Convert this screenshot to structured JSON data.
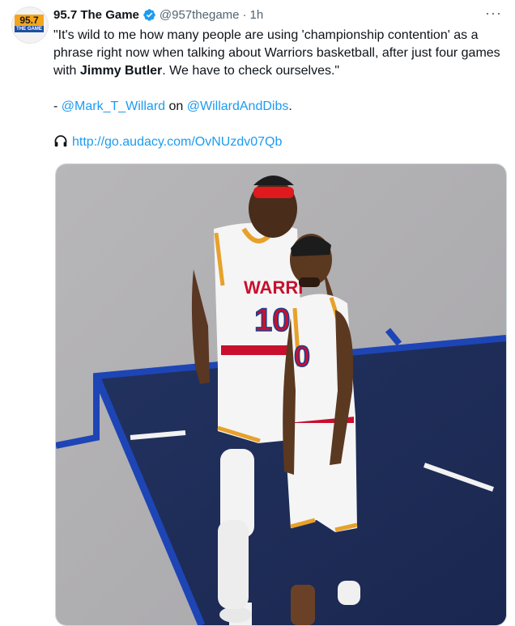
{
  "account": {
    "name": "95.7 The Game",
    "handle": "@957thegame",
    "separator": "·",
    "time": "1h",
    "avatar_lines": [
      "95.7",
      "THE GAME"
    ],
    "verified_icon": "verified-badge-icon",
    "more_label": "···"
  },
  "tweet": {
    "quote_part1": "\"It's wild to me how many people are using 'championship contention' as a phrase right now when talking about Warriors basketball, after just four games with ",
    "quote_bold": "Jimmy Butler",
    "quote_part2": ". We have to check ourselves.\"",
    "attribution_prefix": "- ",
    "attribution_user": "@Mark_T_Willard",
    "attribution_mid": " on ",
    "attribution_show": "@WillardAndDibs",
    "attribution_end": ".",
    "link_icon": "headphones-icon",
    "link_url": "http://go.audacy.com/OvNUzdv07Qb"
  },
  "media": {
    "jersey_1_text": "WARRI",
    "jersey_1_number": "10",
    "jersey_2_number": "0",
    "accent_colors": {
      "court_blue": "#1e45b5",
      "warriors_gold": "#e7a12b",
      "warriors_red": "#c8102e"
    }
  },
  "colors": {
    "link": "#1d9bf0",
    "muted": "#536471",
    "text": "#0f1419"
  }
}
